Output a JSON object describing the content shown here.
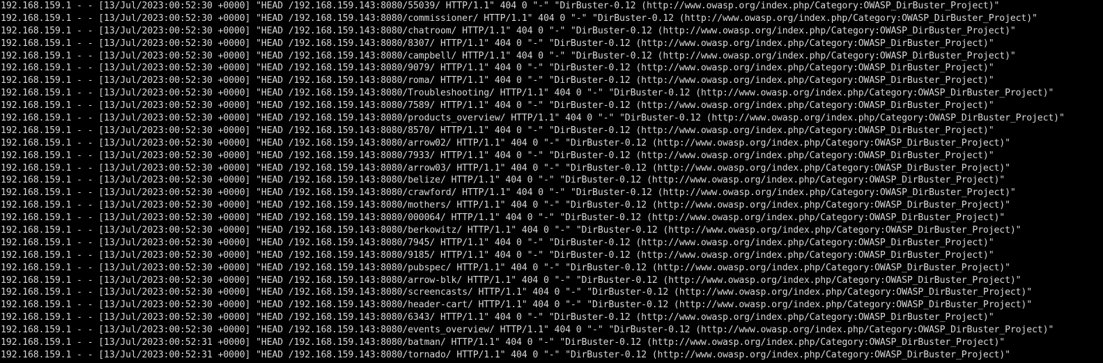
{
  "terminal": {
    "lines": [
      "192.168.159.1 - - [13/Jul/2023:00:52:30 +0000] \"HEAD /192.168.159.143:8080/55039/ HTTP/1.1\" 404 0 \"-\" \"DirBuster-0.12 (http://www.owasp.org/index.php/Category:OWASP_DirBuster_Project)\"",
      "192.168.159.1 - - [13/Jul/2023:00:52:30 +0000] \"HEAD /192.168.159.143:8080/commissioner/ HTTP/1.1\" 404 0 \"-\" \"DirBuster-0.12 (http://www.owasp.org/index.php/Category:OWASP_DirBuster_Project)\"",
      "192.168.159.1 - - [13/Jul/2023:00:52:30 +0000] \"HEAD /192.168.159.143:8080/chatroom/ HTTP/1.1\" 404 0 \"-\" \"DirBuster-0.12 (http://www.owasp.org/index.php/Category:OWASP_DirBuster_Project)\"",
      "192.168.159.1 - - [13/Jul/2023:00:52:30 +0000] \"HEAD /192.168.159.143:8080/8307/ HTTP/1.1\" 404 0 \"-\" \"DirBuster-0.12 (http://www.owasp.org/index.php/Category:OWASP_DirBuster_Project)\"",
      "192.168.159.1 - - [13/Jul/2023:00:52:30 +0000] \"HEAD /192.168.159.143:8080/campbell/ HTTP/1.1\" 404 0 \"-\" \"DirBuster-0.12 (http://www.owasp.org/index.php/Category:OWASP_DirBuster_Project)\"",
      "192.168.159.1 - - [13/Jul/2023:00:52:30 +0000] \"HEAD /192.168.159.143:8080/9079/ HTTP/1.1\" 404 0 \"-\" \"DirBuster-0.12 (http://www.owasp.org/index.php/Category:OWASP_DirBuster_Project)\"",
      "192.168.159.1 - - [13/Jul/2023:00:52:30 +0000] \"HEAD /192.168.159.143:8080/roma/ HTTP/1.1\" 404 0 \"-\" \"DirBuster-0.12 (http://www.owasp.org/index.php/Category:OWASP_DirBuster_Project)\"",
      "192.168.159.1 - - [13/Jul/2023:00:52:30 +0000] \"HEAD /192.168.159.143:8080/Troubleshooting/ HTTP/1.1\" 404 0 \"-\" \"DirBuster-0.12 (http://www.owasp.org/index.php/Category:OWASP_DirBuster_Project)\"",
      "192.168.159.1 - - [13/Jul/2023:00:52:30 +0000] \"HEAD /192.168.159.143:8080/7589/ HTTP/1.1\" 404 0 \"-\" \"DirBuster-0.12 (http://www.owasp.org/index.php/Category:OWASP_DirBuster_Project)\"",
      "192.168.159.1 - - [13/Jul/2023:00:52:30 +0000] \"HEAD /192.168.159.143:8080/products_overview/ HTTP/1.1\" 404 0 \"-\" \"DirBuster-0.12 (http://www.owasp.org/index.php/Category:OWASP_DirBuster_Project)\"",
      "192.168.159.1 - - [13/Jul/2023:00:52:30 +0000] \"HEAD /192.168.159.143:8080/8570/ HTTP/1.1\" 404 0 \"-\" \"DirBuster-0.12 (http://www.owasp.org/index.php/Category:OWASP_DirBuster_Project)\"",
      "192.168.159.1 - - [13/Jul/2023:00:52:30 +0000] \"HEAD /192.168.159.143:8080/arrow02/ HTTP/1.1\" 404 0 \"-\" \"DirBuster-0.12 (http://www.owasp.org/index.php/Category:OWASP_DirBuster_Project)\"",
      "192.168.159.1 - - [13/Jul/2023:00:52:30 +0000] \"HEAD /192.168.159.143:8080/7933/ HTTP/1.1\" 404 0 \"-\" \"DirBuster-0.12 (http://www.owasp.org/index.php/Category:OWASP_DirBuster_Project)\"",
      "192.168.159.1 - - [13/Jul/2023:00:52:30 +0000] \"HEAD /192.168.159.143:8080/arrow03/ HTTP/1.1\" 404 0 \"-\" \"DirBuster-0.12 (http://www.owasp.org/index.php/Category:OWASP_DirBuster_Project)\"",
      "192.168.159.1 - - [13/Jul/2023:00:52:30 +0000] \"HEAD /192.168.159.143:8080/belize/ HTTP/1.1\" 404 0 \"-\" \"DirBuster-0.12 (http://www.owasp.org/index.php/Category:OWASP_DirBuster_Project)\"",
      "192.168.159.1 - - [13/Jul/2023:00:52:30 +0000] \"HEAD /192.168.159.143:8080/crawford/ HTTP/1.1\" 404 0 \"-\" \"DirBuster-0.12 (http://www.owasp.org/index.php/Category:OWASP_DirBuster_Project)\"",
      "192.168.159.1 - - [13/Jul/2023:00:52:30 +0000] \"HEAD /192.168.159.143:8080/mothers/ HTTP/1.1\" 404 0 \"-\" \"DirBuster-0.12 (http://www.owasp.org/index.php/Category:OWASP_DirBuster_Project)\"",
      "192.168.159.1 - - [13/Jul/2023:00:52:30 +0000] \"HEAD /192.168.159.143:8080/000064/ HTTP/1.1\" 404 0 \"-\" \"DirBuster-0.12 (http://www.owasp.org/index.php/Category:OWASP_DirBuster_Project)\"",
      "192.168.159.1 - - [13/Jul/2023:00:52:30 +0000] \"HEAD /192.168.159.143:8080/berkowitz/ HTTP/1.1\" 404 0 \"-\" \"DirBuster-0.12 (http://www.owasp.org/index.php/Category:OWASP_DirBuster_Project)\"",
      "192.168.159.1 - - [13/Jul/2023:00:52:30 +0000] \"HEAD /192.168.159.143:8080/7945/ HTTP/1.1\" 404 0 \"-\" \"DirBuster-0.12 (http://www.owasp.org/index.php/Category:OWASP_DirBuster_Project)\"",
      "192.168.159.1 - - [13/Jul/2023:00:52:30 +0000] \"HEAD /192.168.159.143:8080/9185/ HTTP/1.1\" 404 0 \"-\" \"DirBuster-0.12 (http://www.owasp.org/index.php/Category:OWASP_DirBuster_Project)\"",
      "192.168.159.1 - - [13/Jul/2023:00:52:30 +0000] \"HEAD /192.168.159.143:8080/pubspec/ HTTP/1.1\" 404 0 \"-\" \"DirBuster-0.12 (http://www.owasp.org/index.php/Category:OWASP_DirBuster_Project)\"",
      "192.168.159.1 - - [13/Jul/2023:00:52:30 +0000] \"HEAD /192.168.159.143:8080/arrow-blk/ HTTP/1.1\" 404 0 \"-\" \"DirBuster-0.12 (http://www.owasp.org/index.php/Category:OWASP_DirBuster_Project)\"",
      "192.168.159.1 - - [13/Jul/2023:00:52:30 +0000] \"HEAD /192.168.159.143:8080/screencasts/ HTTP/1.1\" 404 0 \"-\" \"DirBuster-0.12 (http://www.owasp.org/index.php/Category:OWASP_DirBuster_Project)\"",
      "192.168.159.1 - - [13/Jul/2023:00:52:30 +0000] \"HEAD /192.168.159.143:8080/header-cart/ HTTP/1.1\" 404 0 \"-\" \"DirBuster-0.12 (http://www.owasp.org/index.php/Category:OWASP_DirBuster_Project)\"",
      "192.168.159.1 - - [13/Jul/2023:00:52:30 +0000] \"HEAD /192.168.159.143:8080/6343/ HTTP/1.1\" 404 0 \"-\" \"DirBuster-0.12 (http://www.owasp.org/index.php/Category:OWASP_DirBuster_Project)\"",
      "192.168.159.1 - - [13/Jul/2023:00:52:30 +0000] \"HEAD /192.168.159.143:8080/events_overview/ HTTP/1.1\" 404 0 \"-\" \"DirBuster-0.12 (http://www.owasp.org/index.php/Category:OWASP_DirBuster_Project)\"",
      "192.168.159.1 - - [13/Jul/2023:00:52:31 +0000] \"HEAD /192.168.159.143:8080/batman/ HTTP/1.1\" 404 0 \"-\" \"DirBuster-0.12 (http://www.owasp.org/index.php/Category:OWASP_DirBuster_Project)\"",
      "192.168.159.1 - - [13/Jul/2023:00:52:31 +0000] \"HEAD /192.168.159.143:8080/tornado/ HTTP/1.1\" 404 0 \"-\" \"DirBuster-0.12 (http://www.owasp.org/index.php/Category:OWASP_DirBuster_Project)\""
    ],
    "colors": {
      "background": "#000000",
      "text": "#d8d8d8"
    }
  }
}
